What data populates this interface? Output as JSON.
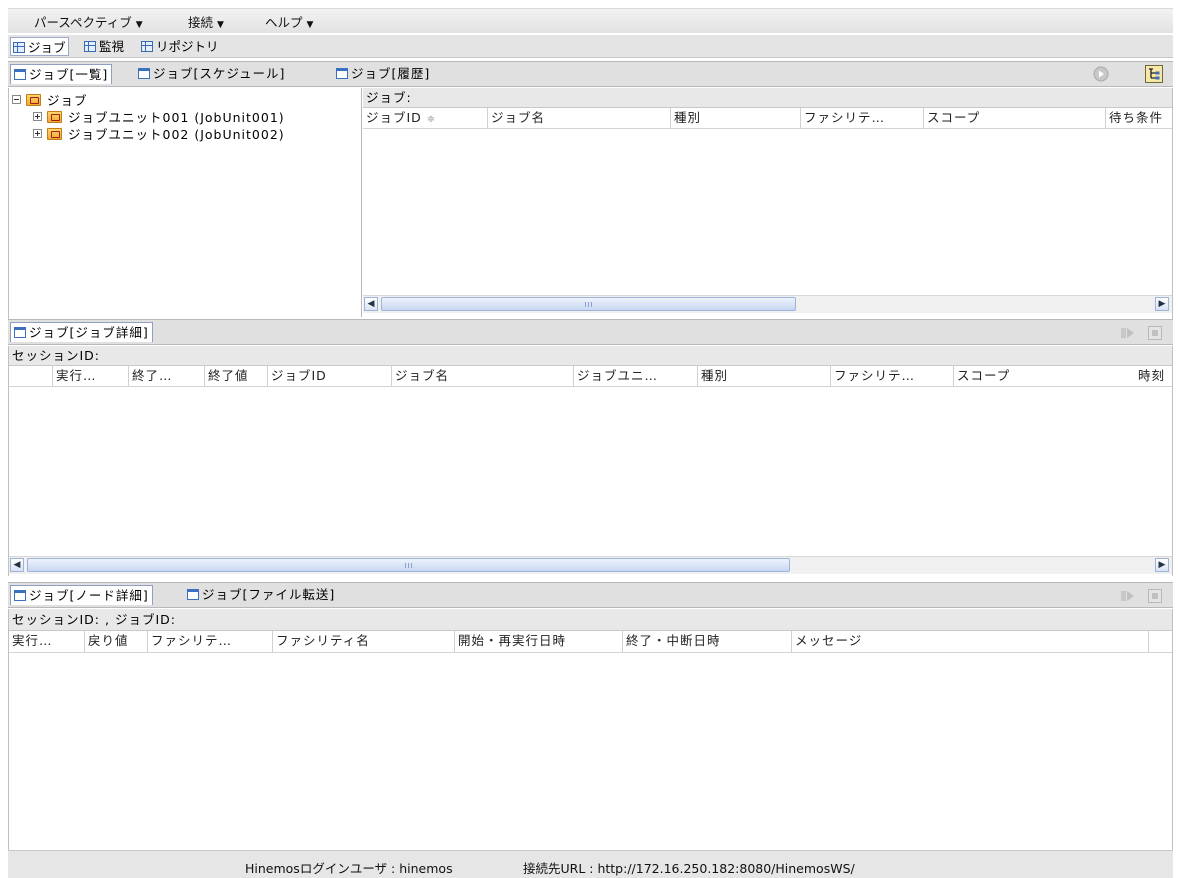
{
  "menubar": {
    "items": [
      {
        "label": "パースペクティブ",
        "arrow": "▼"
      },
      {
        "label": "接続",
        "arrow": "▼"
      },
      {
        "label": "ヘルプ",
        "arrow": "▼"
      }
    ]
  },
  "perspectives": [
    "ジョブ",
    "監視",
    "リポジトリ"
  ],
  "job_list_view": {
    "tabs": [
      "ジョブ[一覧]",
      "ジョブ[スケジュール]",
      "ジョブ[履歴]"
    ],
    "tree": {
      "root": "ジョブ",
      "children": [
        "ジョブユニット001 (JobUnit001)",
        "ジョブユニット002 (JobUnit002)"
      ]
    },
    "table_label": "ジョブ:",
    "columns": [
      "ジョブID",
      "ジョブ名",
      "種別",
      "ファシリテ…",
      "スコープ",
      "待ち条件"
    ],
    "sort_indicator": "≑"
  },
  "job_detail_view": {
    "tab": "ジョブ[ジョブ詳細]",
    "session_label": "セッションID:",
    "columns": [
      "",
      "実行…",
      "終了…",
      "終了値",
      "ジョブID",
      "ジョブ名",
      "ジョブユニ…",
      "種別",
      "ファシリテ…",
      "スコープ",
      "時刻"
    ]
  },
  "node_detail_view": {
    "tabs": [
      "ジョブ[ノード詳細]",
      "ジョブ[ファイル転送]"
    ],
    "session_label": "セッションID: , ジョブID:",
    "columns": [
      "実行…",
      "戻り値",
      "ファシリテ…",
      "ファシリティ名",
      "開始・再実行日時",
      "終了・中断日時",
      "メッセージ"
    ]
  },
  "statusbar": {
    "user": "Hinemosログインユーザ : hinemos",
    "url": "接続先URL : http://172.16.250.182:8080/HinemosWS/"
  },
  "colors": {
    "accent": "#3b6fc0",
    "tab_border": "#8f9fc0",
    "panel_bg": "#e0e0e0"
  }
}
